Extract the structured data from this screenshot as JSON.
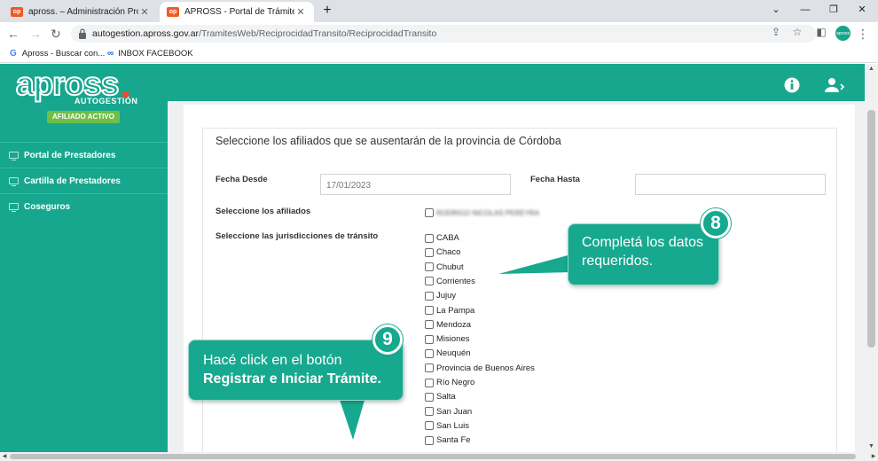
{
  "browser": {
    "tabs": [
      {
        "label": "apross. – Administración Provincial",
        "favicon": "op"
      },
      {
        "label": "APROSS - Portal de Trámites en L",
        "favicon": "op"
      }
    ],
    "url_host": "autogestion.apross.gov.ar",
    "url_path": "/TramitesWeb/ReciprocidadTransito/ReciprocidadTransito",
    "bookmarks": [
      "Apross - Buscar con...",
      "INBOX FACEBOOK"
    ],
    "profile_label": "apross"
  },
  "app": {
    "logo_word": "apross",
    "logo_sub": "AUTOGESTIÓN",
    "badge": "AFILIADO ACTIVO",
    "colors": {
      "primary": "#16a78e",
      "badge": "#6fbf47",
      "logo_dot": "#e74c3c"
    }
  },
  "sidebar": {
    "items": [
      {
        "label": "Portal de Prestadores"
      },
      {
        "label": "Cartilla de Prestadores"
      },
      {
        "label": "Coseguros"
      }
    ]
  },
  "form": {
    "title": "Seleccione los afiliados que se ausentarán de la provincia de Córdoba",
    "fecha_desde_label": "Fecha Desde",
    "fecha_desde_value": "17/01/2023",
    "fecha_hasta_label": "Fecha Hasta",
    "fecha_hasta_value": "",
    "afiliados_label": "Seleccione los afiliados",
    "afiliado_name": "RODRIGO NICOLAS PEREYRA",
    "jurisdicciones_label": "Seleccione las jurisdicciones de tránsito",
    "jurisdicciones": [
      "CABA",
      "Chaco",
      "Chubut",
      "Corrientes",
      "Jujuy",
      "La Pampa",
      "Mendoza",
      "Misiones",
      "Neuquén",
      "Provincia de Buenos Aires",
      "Río Negro",
      "Salta",
      "San Juan",
      "San Luis",
      "Santa Fe"
    ]
  },
  "callouts": {
    "step8": {
      "number": "8",
      "line1": "Completá los datos",
      "line2": "requeridos."
    },
    "step9": {
      "number": "9",
      "line1": "Hacé click en el botón",
      "line2": "Registrar e Iniciar Trámite."
    }
  }
}
